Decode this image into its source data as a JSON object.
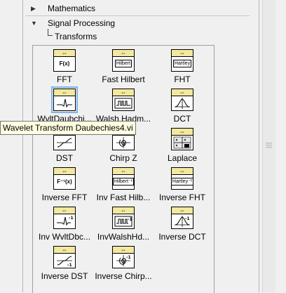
{
  "categories": [
    {
      "label": "Mathematics",
      "state": "collapsed"
    },
    {
      "label": "Signal Processing",
      "state": "expanded"
    }
  ],
  "subcategory": {
    "label": "Transforms"
  },
  "tooltip": {
    "text": "Wavelet Transform Daubechies4.vi"
  },
  "connector_symbol": "⇔",
  "items": [
    {
      "label": "FFT",
      "icon": "fft-icon",
      "glyph": "F(x)"
    },
    {
      "label": "Fast Hilbert",
      "icon": "fast-hilbert-icon",
      "glyph": "Hilbert"
    },
    {
      "label": "FHT",
      "icon": "fht-icon",
      "glyph": "Hartley"
    },
    {
      "label": "WvltDaubchi...",
      "icon": "wavelet-daubechies-icon",
      "selected": true
    },
    {
      "label": "Walsh Hadm...",
      "icon": "walsh-hadamard-icon"
    },
    {
      "label": "DCT",
      "icon": "dct-icon"
    },
    {
      "label": "DST",
      "icon": "dst-icon"
    },
    {
      "label": "Chirp Z",
      "icon": "chirp-z-icon"
    },
    {
      "label": "Laplace",
      "icon": "laplace-icon"
    },
    {
      "label": "Inverse FFT",
      "icon": "inverse-fft-icon",
      "glyph": "F⁻¹(x)"
    },
    {
      "label": "Inv Fast Hilb...",
      "icon": "inverse-fast-hilbert-icon",
      "glyph": "Hilbert⁻¹"
    },
    {
      "label": "Inverse FHT",
      "icon": "inverse-fht-icon",
      "glyph": "Hartley⁻¹"
    },
    {
      "label": "Inv WvltDbc...",
      "icon": "inverse-wavelet-icon"
    },
    {
      "label": "InvWalshHd...",
      "icon": "inverse-walsh-hadamard-icon"
    },
    {
      "label": "Inverse DCT",
      "icon": "inverse-dct-icon"
    },
    {
      "label": "Inverse DST",
      "icon": "inverse-dst-icon"
    },
    {
      "label": "Inverse Chirp...",
      "icon": "inverse-chirp-z-icon"
    }
  ],
  "colors": {
    "icon_connector": "#f2e8a0",
    "selection": "#7eb4ea",
    "tooltip_bg": "#ffffe1"
  }
}
